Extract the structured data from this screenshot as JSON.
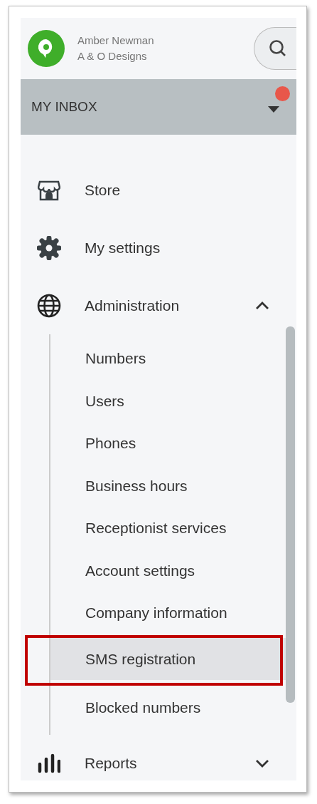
{
  "account": {
    "name": "Amber Newman",
    "company": "A & O Designs"
  },
  "inbox": {
    "label": "MY INBOX",
    "has_notification": true
  },
  "menu": [
    {
      "kind": "store",
      "label": "Store"
    },
    {
      "kind": "settings",
      "label": "My settings"
    },
    {
      "kind": "globe",
      "label": "Administration",
      "expanded": true,
      "children": [
        {
          "label": "Numbers",
          "selected": false
        },
        {
          "label": "Users",
          "selected": false
        },
        {
          "label": "Phones",
          "selected": false
        },
        {
          "label": "Business hours",
          "selected": false
        },
        {
          "label": "Receptionist services",
          "selected": false
        },
        {
          "label": "Account settings",
          "selected": false
        },
        {
          "label": "Company information",
          "selected": false
        },
        {
          "label": "SMS registration",
          "selected": true,
          "annotated": true
        },
        {
          "label": "Blocked numbers",
          "selected": false
        }
      ]
    },
    {
      "kind": "bars",
      "label": "Reports",
      "expanded": false
    }
  ]
}
